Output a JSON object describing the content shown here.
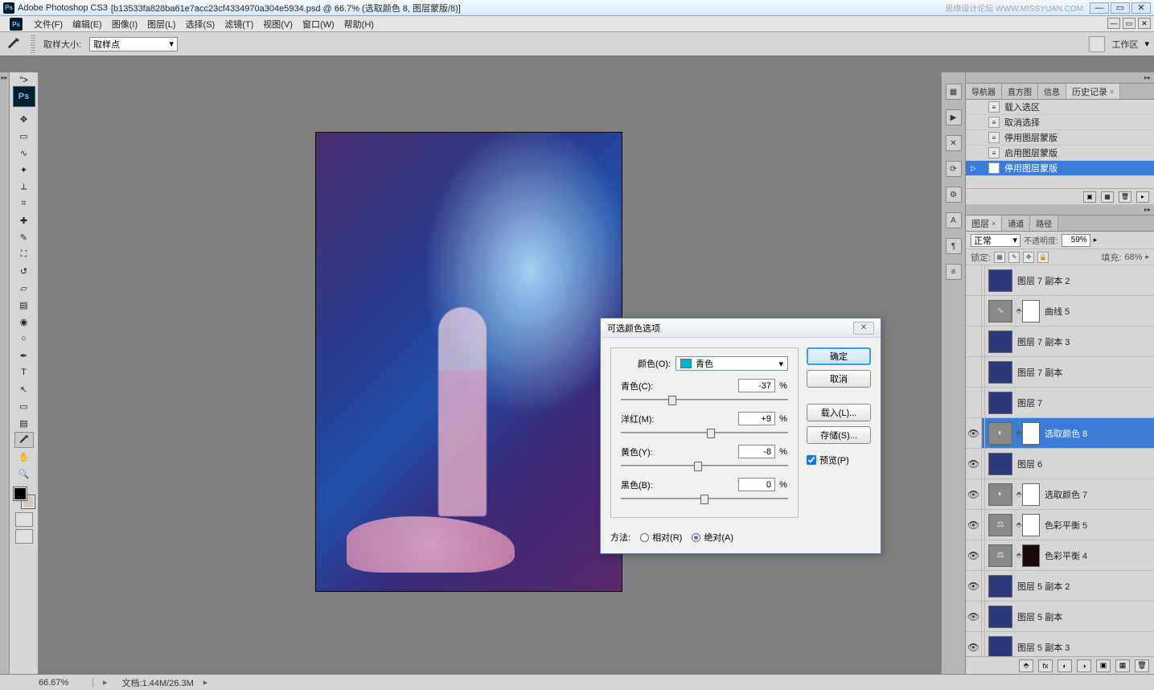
{
  "app": {
    "name": "Adobe Photoshop CS3",
    "document": "[b13533fa828ba61e7acc23cf4334970a304e5934.psd @ 66.7% (选取颜色 8, 图层蒙版/8)]",
    "watermark": "思缘设计论坛   WWW.MISSYUAN.COM"
  },
  "menu": {
    "file": "文件(F)",
    "edit": "编辑(E)",
    "image": "图像(I)",
    "layer": "图层(L)",
    "select": "选择(S)",
    "filter": "滤镜(T)",
    "view": "视图(V)",
    "window": "窗口(W)",
    "help": "帮助(H)"
  },
  "options": {
    "sample_size_label": "取样大小:",
    "sample_size_value": "取样点",
    "workspace_label": "工作区"
  },
  "history_panel": {
    "tabs": {
      "navigator": "导航器",
      "histogram": "直方图",
      "info": "信息",
      "history": "历史记录"
    },
    "items": [
      {
        "label": "载入选区"
      },
      {
        "label": "取消选择"
      },
      {
        "label": "停用图层蒙版"
      },
      {
        "label": "启用图层蒙版"
      },
      {
        "label": "停用图层蒙版",
        "selected": true
      }
    ]
  },
  "layers_panel": {
    "tabs": {
      "layers": "图层",
      "channels": "通道",
      "paths": "路径"
    },
    "blend_mode": "正常",
    "opacity_label": "不透明度:",
    "opacity_value": "59%",
    "lock_label": "锁定:",
    "fill_label": "填充:",
    "fill_value": "68%",
    "layers": [
      {
        "name": "图层 7 副本 2",
        "visible": false,
        "kind": "img"
      },
      {
        "name": "曲线 5",
        "visible": false,
        "kind": "curves",
        "mask": true
      },
      {
        "name": "图层 7 副本 3",
        "visible": false,
        "kind": "img"
      },
      {
        "name": "图层 7 副本",
        "visible": false,
        "kind": "img"
      },
      {
        "name": "图层 7",
        "visible": false,
        "kind": "img"
      },
      {
        "name": "选取颜色 8",
        "visible": true,
        "kind": "sel-color",
        "mask": true,
        "selected": true
      },
      {
        "name": "图层 6",
        "visible": true,
        "kind": "img"
      },
      {
        "name": "选取颜色 7",
        "visible": true,
        "kind": "sel-color",
        "mask": true
      },
      {
        "name": "色彩平衡 5",
        "visible": true,
        "kind": "balance",
        "mask": true
      },
      {
        "name": "色彩平衡 4",
        "visible": true,
        "kind": "balance",
        "mask": true,
        "mask_dark": true
      },
      {
        "name": "图层 5 副本 2",
        "visible": true,
        "kind": "img"
      },
      {
        "name": "图层 5 副本",
        "visible": true,
        "kind": "img"
      },
      {
        "name": "图层 5 副本 3",
        "visible": true,
        "kind": "img"
      }
    ]
  },
  "dialog": {
    "title": "可选颜色选项",
    "color_label": "颜色(O):",
    "color_value": "青色",
    "sliders": {
      "cyan": {
        "label": "青色(C):",
        "value": "-37"
      },
      "magenta": {
        "label": "洋红(M):",
        "value": "+9"
      },
      "yellow": {
        "label": "黄色(Y):",
        "value": "-8"
      },
      "black": {
        "label": "黑色(B):",
        "value": "0"
      }
    },
    "percent": "%",
    "buttons": {
      "ok": "确定",
      "cancel": "取消",
      "load": "载入(L)...",
      "save": "存储(S)..."
    },
    "preview_label": "预览(P)",
    "method_label": "方法:",
    "relative_label": "相对(R)",
    "absolute_label": "绝对(A)"
  },
  "status": {
    "zoom": "66.67%",
    "doc_label": "文档:",
    "doc_size": "1.44M/26.3M"
  }
}
